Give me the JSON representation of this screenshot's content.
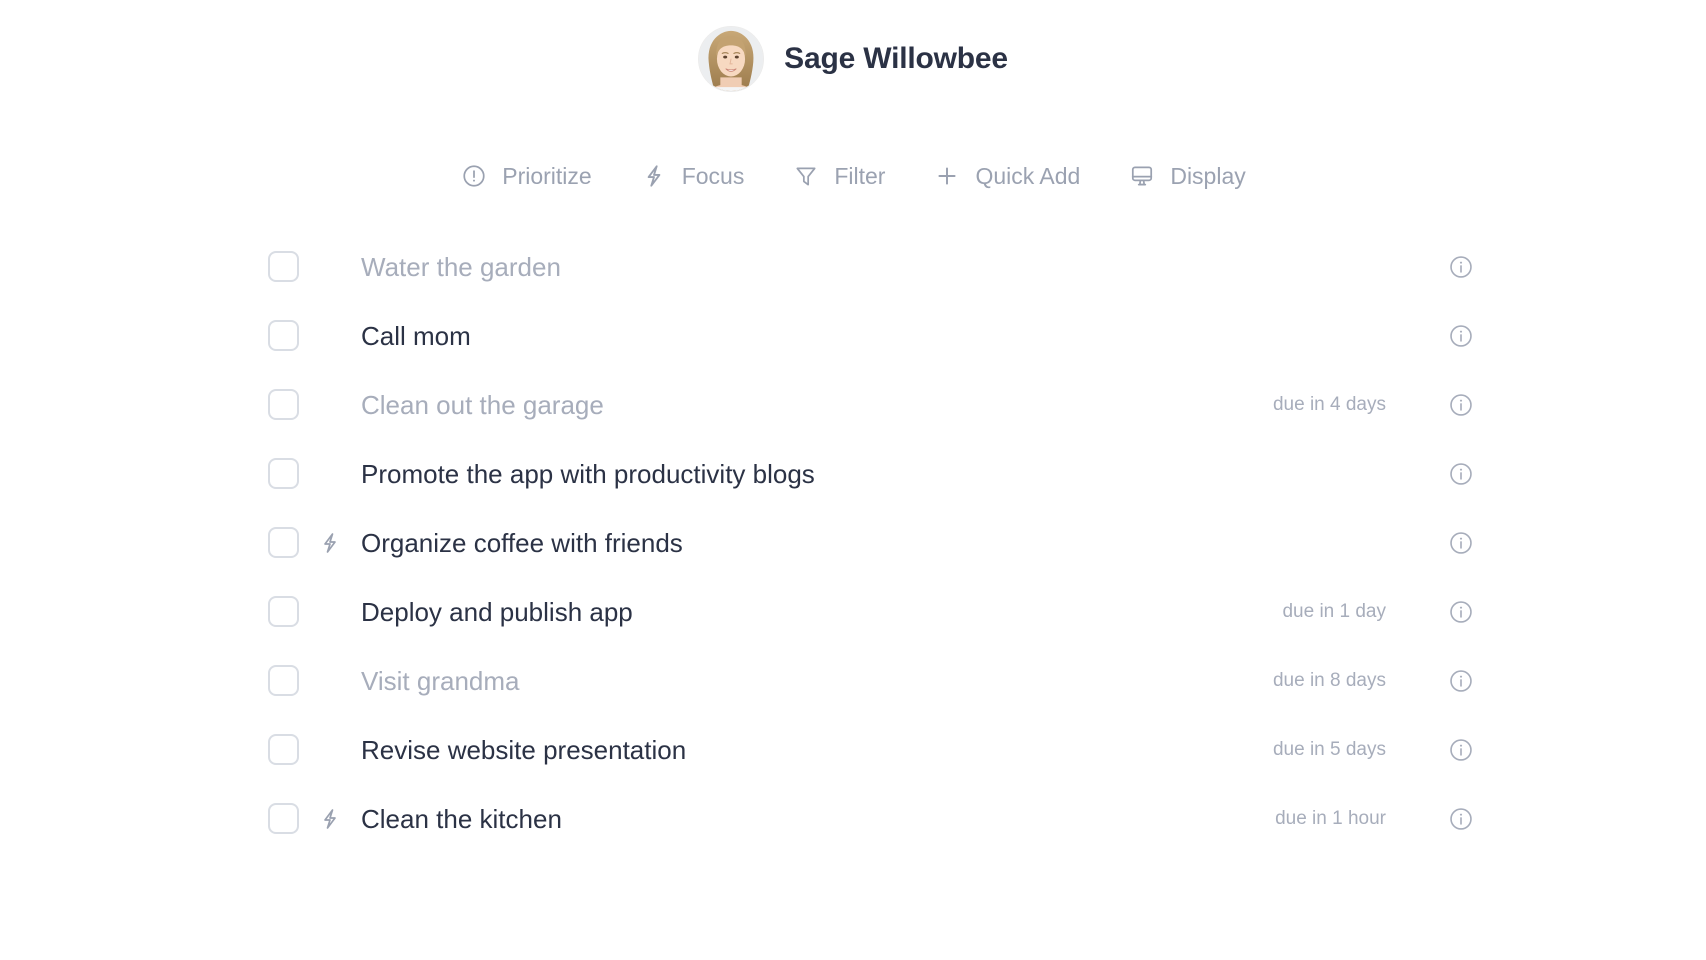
{
  "header": {
    "user_name": "Sage Willowbee",
    "avatar_name": "user-avatar"
  },
  "toolbar": {
    "items": [
      {
        "label": "Prioritize",
        "icon": "exclamation-circle-icon"
      },
      {
        "label": "Focus",
        "icon": "lightning-bolt-icon"
      },
      {
        "label": "Filter",
        "icon": "funnel-icon"
      },
      {
        "label": "Quick Add",
        "icon": "plus-icon"
      },
      {
        "label": "Display",
        "icon": "monitor-icon"
      }
    ]
  },
  "tasks": [
    {
      "title": "Water the garden",
      "due": "",
      "dimmed": true,
      "focused": false
    },
    {
      "title": "Call mom",
      "due": "",
      "dimmed": false,
      "focused": false
    },
    {
      "title": "Clean out the garage",
      "due": "due in 4 days",
      "dimmed": true,
      "focused": false
    },
    {
      "title": "Promote the app with productivity blogs",
      "due": "",
      "dimmed": false,
      "focused": false
    },
    {
      "title": "Organize coffee with friends",
      "due": "",
      "dimmed": false,
      "focused": true
    },
    {
      "title": "Deploy and publish app",
      "due": "due in 1 day",
      "dimmed": false,
      "focused": false
    },
    {
      "title": "Visit grandma",
      "due": "due in 8 days",
      "dimmed": true,
      "focused": false
    },
    {
      "title": "Revise website presentation",
      "due": "due in 5 days",
      "dimmed": false,
      "focused": false
    },
    {
      "title": "Clean the kitchen",
      "due": "due in 1 hour",
      "dimmed": false,
      "focused": true
    }
  ],
  "colors": {
    "text_primary": "#2b3245",
    "text_muted": "#a7adbb",
    "icon_grey": "#9aa1b0",
    "checkbox_border": "#d9dde4",
    "background": "#ffffff"
  }
}
